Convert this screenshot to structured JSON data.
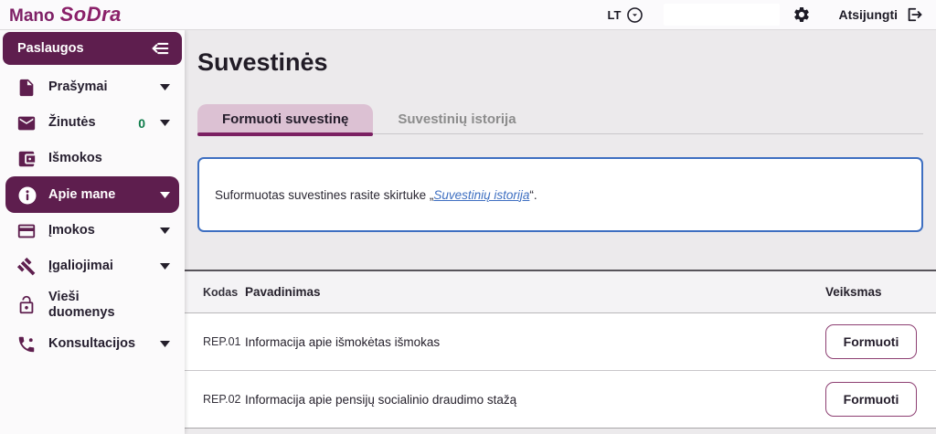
{
  "header": {
    "logo_mano": "Mano",
    "logo_sodra": "SoDra",
    "language": "LT",
    "logout_label": "Atsijungti"
  },
  "icons": {
    "language": "chevron-down-in-circle",
    "settings": "gear",
    "logout": "exit-arrow-right",
    "sidebar_collapse": "arrow-left-with-lines"
  },
  "sidebar": {
    "title": "Paslaugos",
    "items": [
      {
        "label": "Prašymai",
        "icon": "document-icon",
        "chevron": true,
        "active": false
      },
      {
        "label": "Žinutės",
        "icon": "envelope-icon",
        "chevron": true,
        "active": false,
        "badge": "0"
      },
      {
        "label": "Išmokos",
        "icon": "wallet-icon",
        "chevron": false,
        "active": false
      },
      {
        "label": "Apie mane",
        "icon": "info-icon",
        "chevron": true,
        "active": true
      },
      {
        "label": "Įmokos",
        "icon": "credit-card-icon",
        "chevron": true,
        "active": false
      },
      {
        "label": "Įgaliojimai",
        "icon": "gavel-icon",
        "chevron": true,
        "active": false
      },
      {
        "label": "Vieši duomenys",
        "icon": "lock-open-icon",
        "chevron": false,
        "active": false
      },
      {
        "label": "Konsultacijos",
        "icon": "phone-icon",
        "chevron": true,
        "active": false
      }
    ]
  },
  "main": {
    "title": "Suvestinės",
    "tabs": [
      {
        "label": "Formuoti suvestinę",
        "active": true
      },
      {
        "label": "Suvestinių istorija",
        "active": false
      }
    ],
    "notice": {
      "text_before": "Suformuotas suvestines rasite skirtuke „",
      "link": "Suvestinių istorija",
      "text_after": "“."
    },
    "table": {
      "columns": [
        "Kodas",
        "Pavadinimas",
        "Veiksmas"
      ],
      "rows": [
        {
          "code": "REP.01",
          "name": "Informacija apie išmokėtas išmokas",
          "action": "Formuoti"
        },
        {
          "code": "REP.02",
          "name": "Informacija apie pensijų socialinio draudimo stažą",
          "action": "Formuoti"
        }
      ]
    }
  },
  "colors": {
    "brand_purple": "#5e1e4e",
    "logo_magenta": "#8a2069",
    "tab_active_bg": "#dcc1d3",
    "tab_underline": "#7b2062",
    "badge_green": "#0e7c4a",
    "info_border_blue": "#3e6fc1",
    "link_blue": "#3e6fc1"
  }
}
